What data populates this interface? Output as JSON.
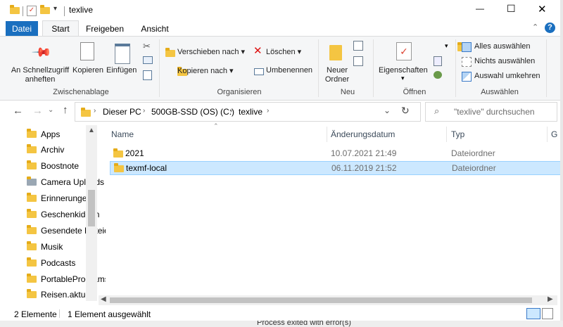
{
  "window": {
    "title": "texlive",
    "minimize": "—",
    "maximize": "☐",
    "close": "✕"
  },
  "ribbon_tabs": [
    {
      "label": "Datei"
    },
    {
      "label": "Start"
    },
    {
      "label": "Freigeben"
    },
    {
      "label": "Ansicht"
    }
  ],
  "ribbon": {
    "clipboard": {
      "pin_label_1": "An Schnellzugriff",
      "pin_label_2": "anheften",
      "copy_label": "Kopieren",
      "paste_label": "Einfügen",
      "group_label": "Zwischenablage"
    },
    "organize": {
      "move_to": "Verschieben nach",
      "copy_to": "Kopieren nach",
      "delete": "Löschen",
      "rename": "Umbenennen",
      "group_label": "Organisieren"
    },
    "new": {
      "new_folder_1": "Neuer",
      "new_folder_2": "Ordner",
      "group_label": "Neu"
    },
    "open": {
      "properties": "Eigenschaften",
      "group_label": "Öffnen"
    },
    "select": {
      "select_all": "Alles auswählen",
      "select_none": "Nichts auswählen",
      "invert": "Auswahl umkehren",
      "group_label": "Auswählen"
    }
  },
  "address": {
    "crumbs": [
      "Dieser PC",
      "500GB-SSD (OS) (C:)",
      "texlive"
    ],
    "search_placeholder": "\"texlive\" durchsuchen"
  },
  "nav_pane": [
    {
      "label": "Apps"
    },
    {
      "label": "Archiv"
    },
    {
      "label": "Boostnote"
    },
    {
      "label": "Camera Uploads"
    },
    {
      "label": "Erinnerungen"
    },
    {
      "label": "Geschenkideen"
    },
    {
      "label": "Gesendete Dateien"
    },
    {
      "label": "Musik"
    },
    {
      "label": "Podcasts"
    },
    {
      "label": "PortablePrograms"
    },
    {
      "label": "Reisen.aktuell"
    }
  ],
  "columns": {
    "name": "Name",
    "date": "Änderungsdatum",
    "type": "Typ",
    "size": "G"
  },
  "files": [
    {
      "name": "2021",
      "date": "10.07.2021 21:49",
      "type": "Dateiordner",
      "selected": false
    },
    {
      "name": "texmf-local",
      "date": "06.11.2019 21:52",
      "type": "Dateiordner",
      "selected": true
    }
  ],
  "status": {
    "count": "2 Elemente",
    "selection": "1 Element ausgewählt"
  },
  "background_text": "Process exited with error(s)",
  "colors": {
    "accent": "#1a6fbf",
    "selection": "#cce8ff",
    "selection_border": "#99d1ff"
  }
}
